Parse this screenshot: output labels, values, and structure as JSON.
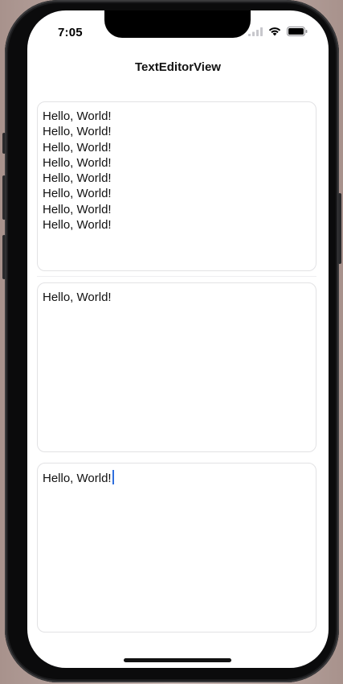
{
  "status_bar": {
    "time": "7:05",
    "icons": [
      "signal-icon",
      "wifi-icon",
      "battery-icon"
    ]
  },
  "nav": {
    "title": "TextEditorView"
  },
  "editors": [
    {
      "lines": [
        "Hello, World!",
        "Hello, World!",
        "Hello, World!",
        "Hello, World!",
        "Hello, World!",
        "Hello, World!",
        "Hello, World!",
        "Hello, World!"
      ]
    },
    {
      "lines": [
        "Hello, World!"
      ]
    },
    {
      "lines": [
        "Hello, World!"
      ],
      "focused": true
    }
  ],
  "colors": {
    "caret": "#2f6fde",
    "editor_border": "#e2e2e4",
    "text": "#111111"
  }
}
